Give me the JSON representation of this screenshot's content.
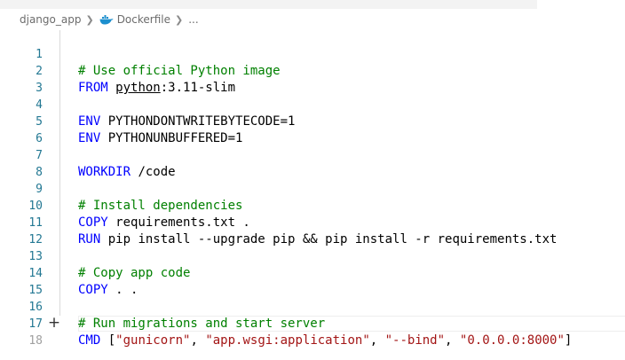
{
  "breadcrumb": {
    "folder": "django_app",
    "file": "Dockerfile",
    "more": "..."
  },
  "editor": {
    "lines": [
      {
        "n": "1",
        "comment": "# Use official Python image"
      },
      {
        "n": "2",
        "kw": "FROM",
        "image": "python",
        "tag": ":3.11-slim"
      },
      {
        "n": "3"
      },
      {
        "n": "4",
        "kw": "ENV",
        "text": " PYTHONDONTWRITEBYTECODE=1"
      },
      {
        "n": "5",
        "kw": "ENV",
        "text": " PYTHONUNBUFFERED=1"
      },
      {
        "n": "6"
      },
      {
        "n": "7",
        "kw": "WORKDIR",
        "text": " /code"
      },
      {
        "n": "8"
      },
      {
        "n": "9",
        "comment": "# Install dependencies"
      },
      {
        "n": "10",
        "kw": "COPY",
        "text": " requirements.txt ."
      },
      {
        "n": "11",
        "kw": "RUN",
        "text": " pip install --upgrade pip && pip install -r requirements.txt"
      },
      {
        "n": "12"
      },
      {
        "n": "13",
        "comment": "# Copy app code"
      },
      {
        "n": "14",
        "kw": "COPY",
        "text": " . ."
      },
      {
        "n": "15"
      },
      {
        "n": "16",
        "comment": "# Run migrations and start server"
      },
      {
        "n": "17",
        "kw": "CMD",
        "p1": " [",
        "s1": "\"gunicorn\"",
        "c1": ", ",
        "s2": "\"app.wsgi:application\"",
        "c2": ", ",
        "s3": "\"--bind\"",
        "c3": ", ",
        "s4": "\"0.0.0.0:8000\"",
        "p2": "]"
      },
      {
        "n": "18"
      }
    ]
  },
  "colors": {
    "keyword": "#0000ff",
    "comment": "#008000",
    "string": "#a31515",
    "line_number": "#237893"
  },
  "icons": {
    "breadcrumb_separator": "chevron-right-icon",
    "file_type": "docker-whale-icon",
    "gutter_action": "plus-icon"
  }
}
